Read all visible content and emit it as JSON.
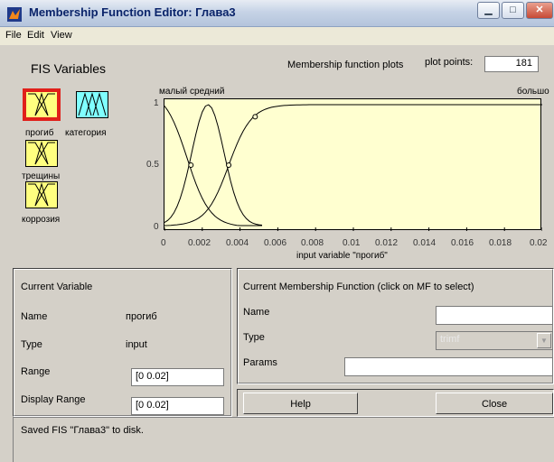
{
  "window": {
    "title": "Membership Function Editor: Глава3",
    "minimize_icon": "minimize-icon",
    "maximize_icon": "maximize-icon",
    "close_icon": "close-icon"
  },
  "menu": [
    "File",
    "Edit",
    "View"
  ],
  "fis_variables": {
    "title": "FIS Variables",
    "inputs": [
      "прогиб",
      "трещины",
      "коррозия"
    ],
    "output": "категория",
    "selected": "прогиб"
  },
  "plot": {
    "title": "Membership function plots",
    "plot_points_label": "plot points:",
    "plot_points_value": "181",
    "mf_labels": [
      "малый",
      "средний",
      "большо"
    ],
    "xlabel": "input variable \"прогиб\"",
    "x_ticks": [
      "0",
      "0.002",
      "0.004",
      "0.006",
      "0.008",
      "0.01",
      "0.012",
      "0.014",
      "0.016",
      "0.018",
      "0.02"
    ],
    "y_ticks": [
      "0",
      "0.5",
      "1"
    ]
  },
  "chart_data": {
    "type": "line",
    "xlabel": "input variable \"прогиб\"",
    "xlim": [
      0,
      0.02
    ],
    "ylim": [
      0,
      1
    ],
    "series": [
      {
        "name": "малый",
        "shape": "z-shaped",
        "x": [
          0,
          0.0012,
          0.002,
          0.0035,
          0.0052
        ],
        "y": [
          1,
          0.6,
          0.25,
          0.05,
          0
        ]
      },
      {
        "name": "средний",
        "shape": "gaussian",
        "x": [
          0,
          0.0013,
          0.0023,
          0.0034,
          0.0052
        ],
        "y": [
          0,
          0.5,
          1,
          0.5,
          0
        ]
      },
      {
        "name": "большо",
        "shape": "s-shaped",
        "x": [
          0,
          0.0034,
          0.0048,
          0.0068,
          0.02
        ],
        "y": [
          0,
          0.5,
          0.9,
          1,
          1
        ]
      }
    ],
    "grid": false
  },
  "current_variable": {
    "title": "Current Variable",
    "name_label": "Name",
    "name_value": "прогиб",
    "type_label": "Type",
    "type_value": "input",
    "range_label": "Range",
    "range_value": "[0 0.02]",
    "display_range_label": "Display Range",
    "display_range_value": "[0 0.02]"
  },
  "current_mf": {
    "title": "Current Membership Function (click on MF to select)",
    "name_label": "Name",
    "name_value": "",
    "type_label": "Type",
    "type_value": "trimf",
    "params_label": "Params",
    "params_value": ""
  },
  "buttons": {
    "help": "Help",
    "close": "Close"
  },
  "status": "Saved FIS \"Глава3\" to disk."
}
